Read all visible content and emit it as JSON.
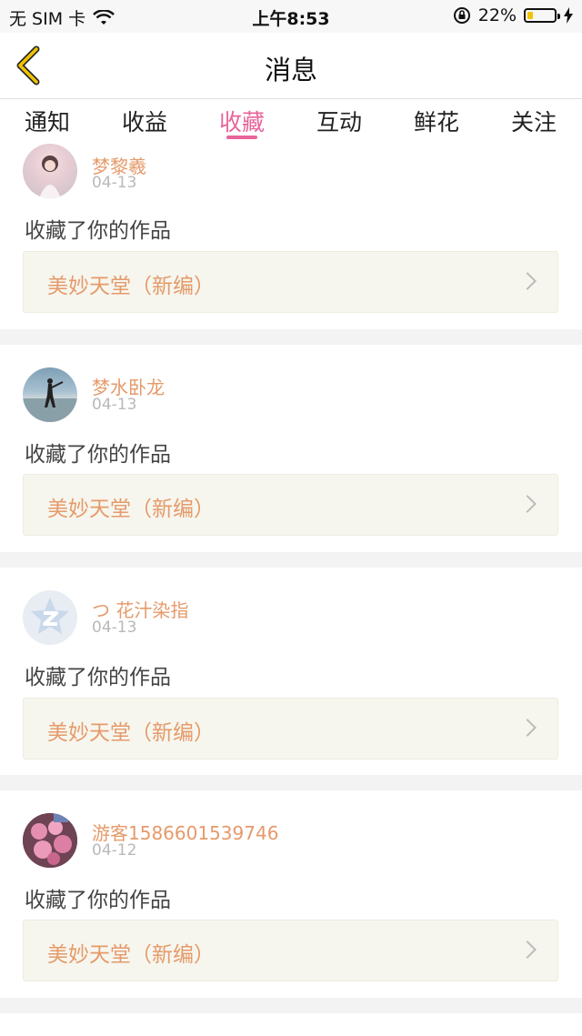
{
  "status_bar": {
    "carrier": "无 SIM 卡",
    "time": "上午8:53",
    "battery": "22%",
    "battery_level": 0.22
  },
  "nav": {
    "title": "消息",
    "back_icon": "chevron-left-icon",
    "accent": "#f0c400"
  },
  "tabs": [
    {
      "label": "通知"
    },
    {
      "label": "收益"
    },
    {
      "label": "收藏",
      "active": true
    },
    {
      "label": "互动"
    },
    {
      "label": "鲜花"
    },
    {
      "label": "关注"
    }
  ],
  "colors": {
    "active_tab": "#e8649b",
    "username": "#e59a6a",
    "work_bg": "#f6f6ee"
  },
  "items": [
    {
      "user": "梦黎羲",
      "date": "04-13",
      "action": "收藏了你的作品",
      "work": "美妙天堂（新编）",
      "avatar": "girl-photo"
    },
    {
      "user": "梦水卧龙",
      "date": "04-13",
      "action": "收藏了你的作品",
      "work": "美妙天堂（新编）",
      "avatar": "beach-photo"
    },
    {
      "user": "つ 花汁染指",
      "date": "04-13",
      "action": "收藏了你的作品",
      "work": "美妙天堂（新编）",
      "avatar": "default-star-icon"
    },
    {
      "user": "游客1586601539746",
      "date": "04-12",
      "action": "收藏了你的作品",
      "work": "美妙天堂（新编）",
      "avatar": "flower-photo"
    }
  ]
}
